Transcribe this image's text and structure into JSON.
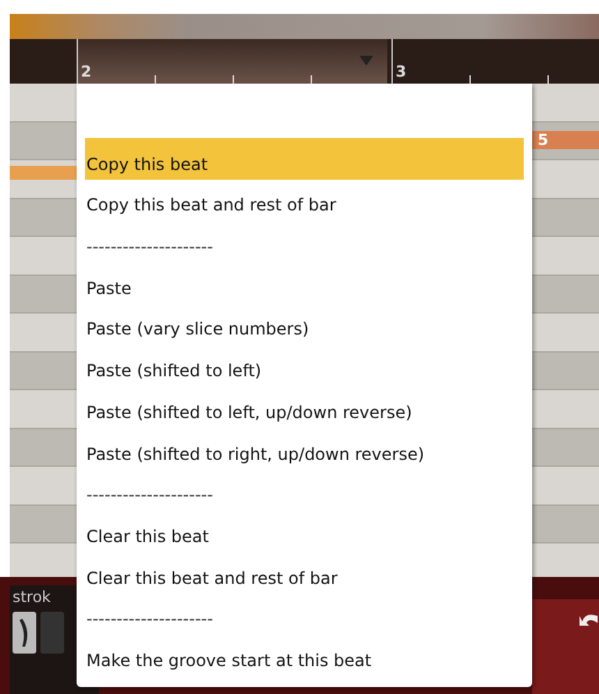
{
  "ruler": {
    "markers": [
      "2",
      "3"
    ]
  },
  "grid": {
    "cell_label": "5"
  },
  "bottom_panel": {
    "label": "strok"
  },
  "context_menu": {
    "items": [
      {
        "kind": "item",
        "label": "Copy this beat",
        "selected": true
      },
      {
        "kind": "item",
        "label": "Copy this beat and rest of bar",
        "selected": false
      },
      {
        "kind": "separator",
        "label": "---------------------"
      },
      {
        "kind": "item",
        "label": "Paste",
        "selected": false
      },
      {
        "kind": "item",
        "label": "Paste (vary slice numbers)",
        "selected": false
      },
      {
        "kind": "item",
        "label": "Paste (shifted to left)",
        "selected": false
      },
      {
        "kind": "item",
        "label": "Paste (shifted to left, up/down reverse)",
        "selected": false
      },
      {
        "kind": "item",
        "label": "Paste (shifted to right, up/down reverse)",
        "selected": false
      },
      {
        "kind": "separator",
        "label": "---------------------"
      },
      {
        "kind": "item",
        "label": "Clear this beat",
        "selected": false
      },
      {
        "kind": "item",
        "label": "Clear this beat and rest of bar",
        "selected": false
      },
      {
        "kind": "separator",
        "label": "---------------------"
      },
      {
        "kind": "item",
        "label": "Make the groove start at this beat",
        "selected": false
      }
    ]
  }
}
